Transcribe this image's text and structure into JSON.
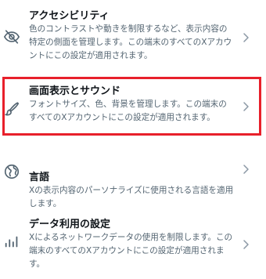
{
  "settings": {
    "items": [
      {
        "icon": "eye-slash-icon",
        "title": "アクセシビリティ",
        "description": "色のコントラストや動きを制限するなど、表示内容の特定の側面を管理します。この端末のすべてのXアカウントにこの設定が適用されます。"
      },
      {
        "icon": "brush-icon",
        "title": "画面表示とサウンド",
        "description": "フォントサイズ、色、背景を管理します。この端末のすべてのXアカウントにこの設定が適用されます。"
      },
      {
        "icon": "globe-icon",
        "title": "言語",
        "description": "Xの表示内容のパーソナライズに使用される言語を適用します。"
      },
      {
        "icon": "bar-chart-icon",
        "title": "データ利用の設定",
        "description": "Xによるネットワークデータの使用を制限します。この端末のすべてのXアカウントにこの設定が適用されます。"
      }
    ],
    "highlight_color": "#e8202b"
  }
}
